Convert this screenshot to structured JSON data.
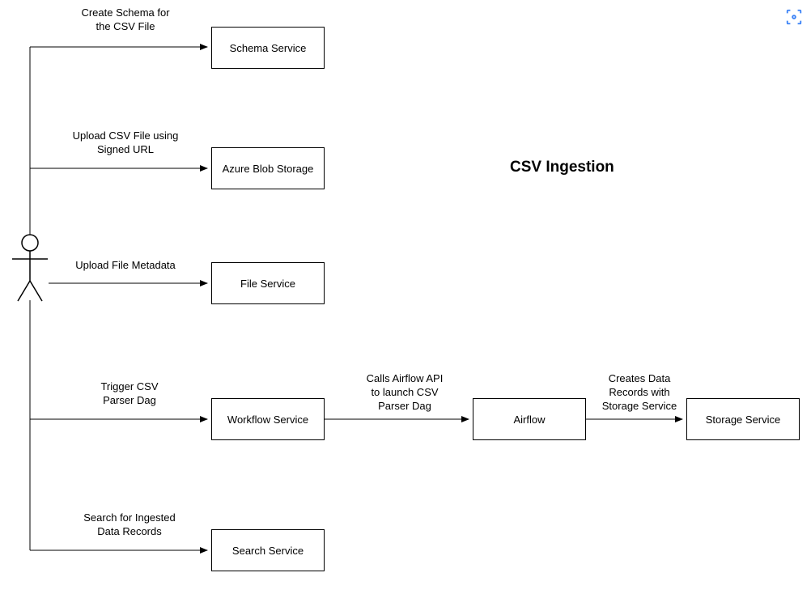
{
  "title": "CSV Ingestion",
  "actor": "user",
  "boxes": {
    "schema_service": "Schema Service",
    "azure_blob": "Azure Blob Storage",
    "file_service": "File Service",
    "workflow_service": "Workflow Service",
    "airflow": "Airflow",
    "storage_service": "Storage Service",
    "search_service": "Search Service"
  },
  "labels": {
    "create_schema": "Create Schema for\nthe CSV File",
    "upload_csv": "Upload CSV File using\nSigned URL",
    "upload_metadata": "Upload File Metadata",
    "trigger_dag": "Trigger CSV\nParser Dag",
    "calls_airflow": "Calls Airflow API\nto launch CSV\nParser Dag",
    "creates_data": "Creates Data\nRecords with\nStorage Service",
    "search_records": "Search for Ingested\nData Records"
  }
}
